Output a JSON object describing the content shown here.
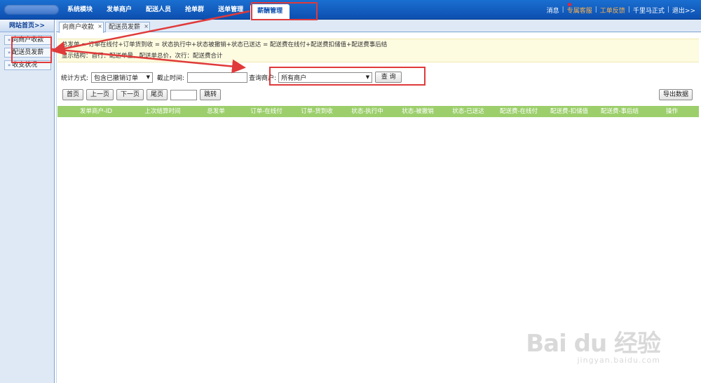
{
  "nav": {
    "items": [
      "系统模块",
      "发单商户",
      "配送人员",
      "抢单群",
      "送单管理",
      "薪酬管理"
    ],
    "active_index": 5,
    "right": {
      "message": "消息",
      "service": "专属客服",
      "feedback": "工单反馈",
      "user": "千里马正式",
      "logout": "退出>>"
    }
  },
  "sidebar": {
    "header": "网站首页>>",
    "items": [
      "向商户收款",
      "配送员发薪",
      "收支状况"
    ]
  },
  "tabs": [
    {
      "label": "向商户收款",
      "active": true
    },
    {
      "label": "配送员发薪",
      "active": false
    }
  ],
  "formula": {
    "line1": "总发单 = 订单在线付+订单货到收 = 状态执行中+状态被撤销+状态已送达 = 配送费在线付+配送费扣储值+配送费事后结",
    "line2": "显示结构：首行：配送单量，配送单总价，次行：配送费合计"
  },
  "filter": {
    "stat_label": "统计方式:",
    "stat_value": "包含已撤销订单",
    "deadline_label": "截止时间:",
    "merchant_label": "查询商户:",
    "merchant_value": "所有商户",
    "query_button": "查 询"
  },
  "pager": {
    "first": "首页",
    "prev": "上一页",
    "next": "下一页",
    "last": "尾页",
    "jump": "跳转"
  },
  "export_button": "导出数据",
  "table": {
    "headers": [
      "发单商户-ID",
      "上次结算时间",
      "总发单",
      "订单-在线付",
      "订单-货到收",
      "状态-执行中",
      "状态-被撤销",
      "状态-已送达",
      "配送费-在线付",
      "配送费-扣储值",
      "配送费-事后结",
      "操作"
    ]
  },
  "watermark": {
    "main": "Bai du 经验",
    "sub": "jingyan.baidu.com"
  },
  "colors": {
    "nav_blue": "#0d4fb0",
    "table_header": "#9ccf6c",
    "annotation_red": "#e03a3a",
    "formula_bg": "#fdfbe0"
  }
}
